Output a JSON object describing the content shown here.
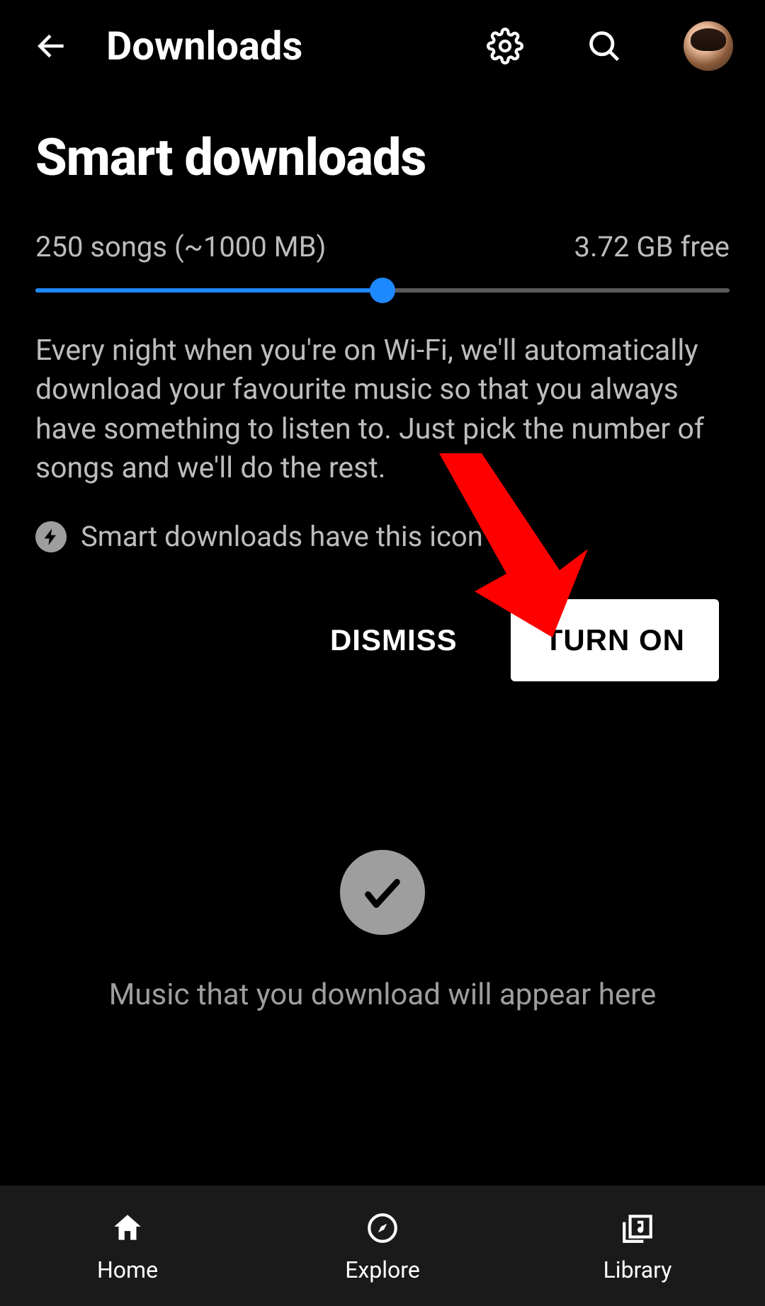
{
  "header": {
    "title": "Downloads"
  },
  "smart_downloads": {
    "title": "Smart downloads",
    "songs_label": "250 songs (~1000 MB)",
    "free_label": "3.72 GB free",
    "slider_percent": 50,
    "description": "Every night when you're on Wi-Fi, we'll automatically download your favourite music so that you always have something to listen to. Just pick the number of songs and we'll do the rest.",
    "hint": "Smart downloads have this icon",
    "dismiss_label": "DISMISS",
    "turn_on_label": "TURN ON"
  },
  "empty_state": {
    "message": "Music that you download will appear here"
  },
  "nav": {
    "home": "Home",
    "explore": "Explore",
    "library": "Library"
  }
}
